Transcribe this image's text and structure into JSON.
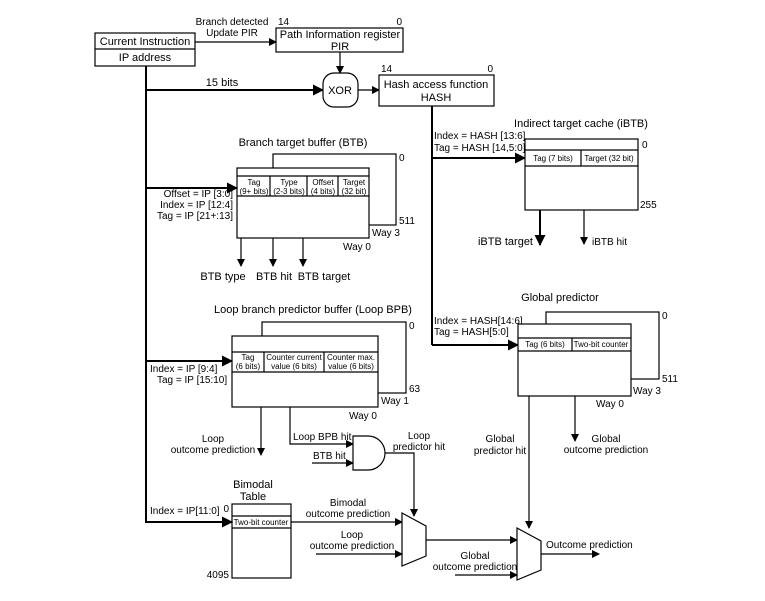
{
  "current_instruction": {
    "title": "Current Instruction",
    "field": "IP address"
  },
  "pir": {
    "label_line1": "Branch detected",
    "label_line2": "Update PIR",
    "bit_high": "14",
    "bit_low": "0",
    "title": "Path Information register",
    "abbr": "PIR"
  },
  "xor": {
    "label": "XOR",
    "input_label": "15 bits"
  },
  "hash": {
    "bit_high": "14",
    "bit_low": "0",
    "title": "Hash access function",
    "abbr": "HASH"
  },
  "ibtb": {
    "title": "Indirect target cache (iBTB)",
    "index": "Index = HASH [13:6]",
    "tag": "Tag = HASH [14,5:0]",
    "fields": [
      "Tag (7 bits)",
      "Target (32 bit)"
    ],
    "row_first": "0",
    "row_last": "255",
    "outputs": [
      "iBTB target",
      "iBTB hit"
    ]
  },
  "btb": {
    "title": "Branch target buffer (BTB)",
    "offset": "Offset = IP [3:0]",
    "index": "Index = IP [12:4]",
    "tag": "Tag = IP [21+:13]",
    "fields": [
      {
        "name": "Tag",
        "size": "(9+ bits)"
      },
      {
        "name": "Type",
        "size": "(2-3 bits)"
      },
      {
        "name": "Offset",
        "size": "(4 bits)"
      },
      {
        "name": "Target",
        "size": "(32 bit)"
      }
    ],
    "row_first": "0",
    "row_last": "511",
    "way_back": "Way 3",
    "way_front": "Way 0",
    "outputs": [
      "BTB type",
      "BTB hit",
      "BTB target"
    ]
  },
  "loop_bpb": {
    "title": "Loop branch predictor buffer (Loop BPB)",
    "index": "Index = IP [9:4]",
    "tag": "Tag = IP [15:10]",
    "fields": [
      {
        "name": "Tag",
        "size": "(6 bits)"
      },
      {
        "name": "Counter current",
        "size": "value (6 bits)"
      },
      {
        "name": "Counter max.",
        "size": "value (6 bits)"
      }
    ],
    "row_first": "0",
    "row_last": "63",
    "way_back": "Way 1",
    "way_front": "Way 0",
    "outcome_line1": "Loop",
    "outcome_line2": "outcome prediction",
    "hit": "Loop BPB hit",
    "btb_hit": "BTB hit",
    "predictor_hit_line1": "Loop",
    "predictor_hit_line2": "predictor hit"
  },
  "global": {
    "title": "Global predictor",
    "index": "Index = HASH[14:6]",
    "tag": "Tag = HASH[5:0]",
    "fields": [
      "Tag (6 bits)",
      "Two-bit counter"
    ],
    "row_first": "0",
    "row_last": "511",
    "way_back": "Way 3",
    "way_front": "Way 0",
    "hit_line1": "Global",
    "hit_line2": "predictor hit",
    "outcome_line1": "Global",
    "outcome_line2": "outcome prediction"
  },
  "bimodal": {
    "title_line1": "Bimodal",
    "title_line2": "Table",
    "index": "Index = IP[11:0]",
    "field": "Two-bit counter",
    "row_first": "0",
    "row_last": "4095",
    "outcome_line1": "Bimodal",
    "outcome_line2": "outcome prediction"
  },
  "mux": {
    "loop_line1": "Loop",
    "loop_line2": "outcome prediction",
    "global_line1": "Global",
    "global_line2": "outcome prediction",
    "output": "Outcome prediction"
  }
}
